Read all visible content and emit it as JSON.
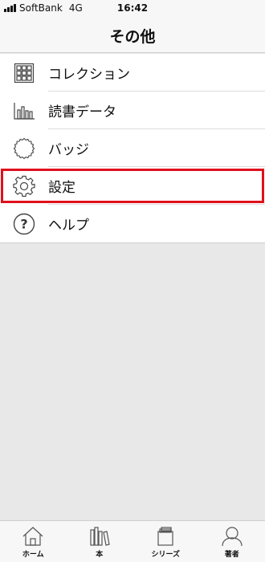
{
  "status_bar": {
    "carrier": "SoftBank",
    "network": "4G",
    "time": "16:42"
  },
  "header": {
    "title": "その他"
  },
  "menu": {
    "items": [
      {
        "label": "コレクション",
        "icon": "grid-icon"
      },
      {
        "label": "読書データ",
        "icon": "bar-chart-icon"
      },
      {
        "label": "バッジ",
        "icon": "badge-icon"
      },
      {
        "label": "設定",
        "icon": "gear-icon",
        "highlighted": true,
        "highlight_color": "#e0101c"
      },
      {
        "label": "ヘルプ",
        "icon": "help-icon"
      }
    ]
  },
  "tab_bar": {
    "tabs": [
      {
        "label": "ホーム",
        "icon": "home-icon"
      },
      {
        "label": "本",
        "icon": "books-icon"
      },
      {
        "label": "シリーズ",
        "icon": "series-icon"
      },
      {
        "label": "著者",
        "icon": "author-icon"
      }
    ]
  }
}
